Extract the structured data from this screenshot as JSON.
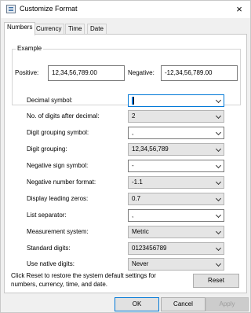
{
  "window": {
    "title": "Customize Format",
    "close_glyph": "×"
  },
  "tabs": [
    {
      "label": "Numbers",
      "active": true
    },
    {
      "label": "Currency",
      "active": false
    },
    {
      "label": "Time",
      "active": false
    },
    {
      "label": "Date",
      "active": false
    }
  ],
  "example": {
    "legend": "Example",
    "positive_label": "Positive:",
    "positive_value": "12,34,56,789.00",
    "negative_label": "Negative:",
    "negative_value": "-12,34,56,789.00"
  },
  "settings": [
    {
      "label": "Decimal symbol:",
      "value": ".",
      "editable": true,
      "focused": true
    },
    {
      "label": "No. of digits after decimal:",
      "value": "2",
      "editable": false
    },
    {
      "label": "Digit grouping symbol:",
      "value": ",",
      "editable": true
    },
    {
      "label": "Digit grouping:",
      "value": "12,34,56,789",
      "editable": false
    },
    {
      "label": "Negative sign symbol:",
      "value": "-",
      "editable": true
    },
    {
      "label": "Negative number format:",
      "value": "-1.1",
      "editable": false
    },
    {
      "label": "Display leading zeros:",
      "value": "0.7",
      "editable": false
    },
    {
      "label": "List separator:",
      "value": ",",
      "editable": true
    },
    {
      "label": "Measurement system:",
      "value": "Metric",
      "editable": false
    },
    {
      "label": "Standard digits:",
      "value": "0123456789",
      "editable": false
    },
    {
      "label": "Use native digits:",
      "value": "Never",
      "editable": false
    }
  ],
  "reset": {
    "note": "Click Reset to restore the system default settings for numbers, currency, time, and date.",
    "button_label": "Reset"
  },
  "footer": {
    "ok_label": "OK",
    "cancel_label": "Cancel",
    "apply_label": "Apply"
  },
  "colors": {
    "focus_accent": "#0078d7",
    "window_bg": "#f0f0f0",
    "panel_bg": "#ffffff"
  }
}
